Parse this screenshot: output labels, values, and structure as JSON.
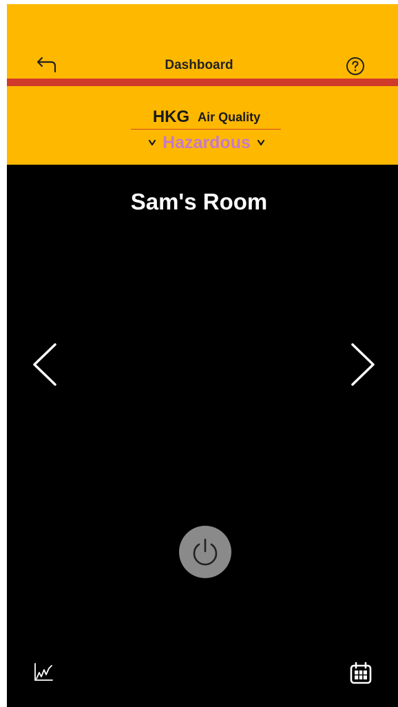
{
  "header": {
    "title": "Dashboard",
    "back_icon": "back-arrow-icon",
    "help_icon": "help-circle-icon",
    "background_color": "#FFB800",
    "divider_color": "#D03A2A"
  },
  "air_quality": {
    "city": "HKG",
    "label": "Air Quality",
    "level": "Hazardous",
    "level_color": "#C57BC9",
    "prev_icon": "chevron-down-icon",
    "next_icon": "chevron-down-icon"
  },
  "room": {
    "name": "Sam's Room",
    "prev_icon": "chevron-left-icon",
    "next_icon": "chevron-right-icon"
  },
  "controls": {
    "power_icon": "power-icon",
    "power_color": "#8a8a8a"
  },
  "footer": {
    "chart_icon": "line-chart-icon",
    "calendar_icon": "calendar-icon"
  }
}
